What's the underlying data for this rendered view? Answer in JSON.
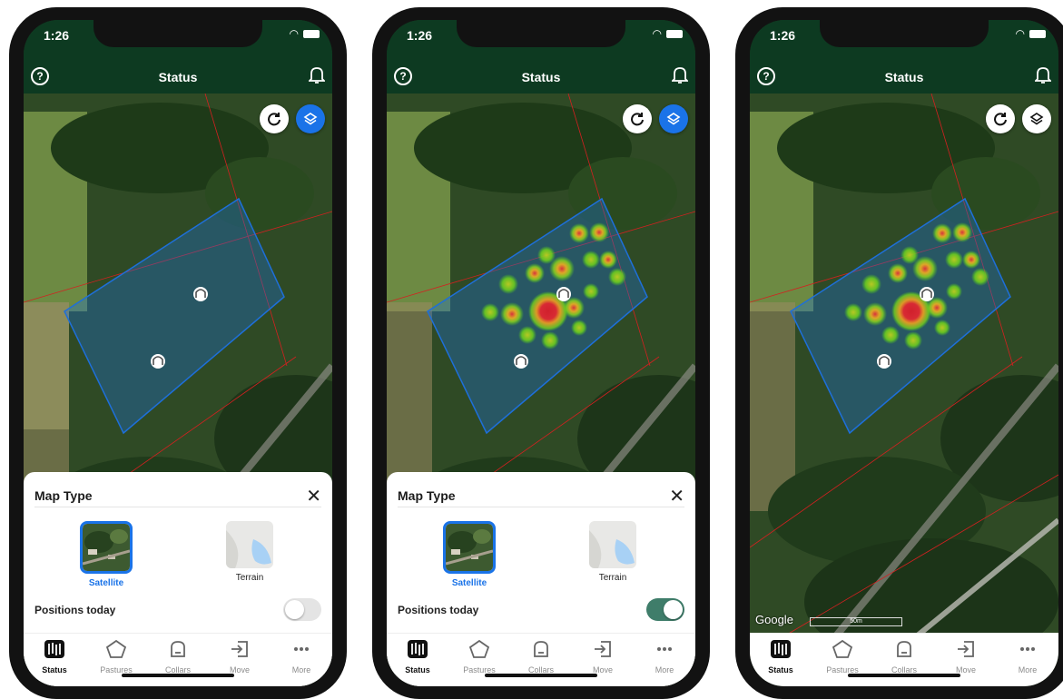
{
  "colors": {
    "header": "#0d3a21",
    "accent_blue": "#1a73e8",
    "toggle_on": "#3f7d6a",
    "pasture_fill": "#1e6fd9"
  },
  "phones": [
    {
      "time": "1:26",
      "title": "Status",
      "icons": {
        "help": "help-circle-icon",
        "bell": "bell-icon",
        "refresh": "refresh-icon",
        "layers": "layers-icon"
      },
      "sheet": {
        "title": "Map Type",
        "options": [
          {
            "label": "Satellite"
          },
          {
            "label": "Terrain"
          }
        ],
        "positions_label": "Positions today"
      },
      "tabs": [
        "Status",
        "Pastures",
        "Collars",
        "Move",
        "More"
      ]
    },
    {
      "time": "1:26",
      "title": "Status",
      "sheet": {
        "title": "Map Type",
        "options": [
          {
            "label": "Satellite"
          },
          {
            "label": "Terrain"
          }
        ],
        "positions_label": "Positions today"
      },
      "tabs": [
        "Status",
        "Pastures",
        "Collars",
        "Move",
        "More"
      ]
    },
    {
      "time": "1:26",
      "title": "Status",
      "map_attribution": "Google",
      "scale_label": "50m",
      "tabs": [
        "Status",
        "Pastures",
        "Collars",
        "Move",
        "More"
      ]
    }
  ],
  "state": {
    "selected_map_type": "Satellite",
    "positions_today_phone1": false,
    "positions_today_phone2": true
  }
}
